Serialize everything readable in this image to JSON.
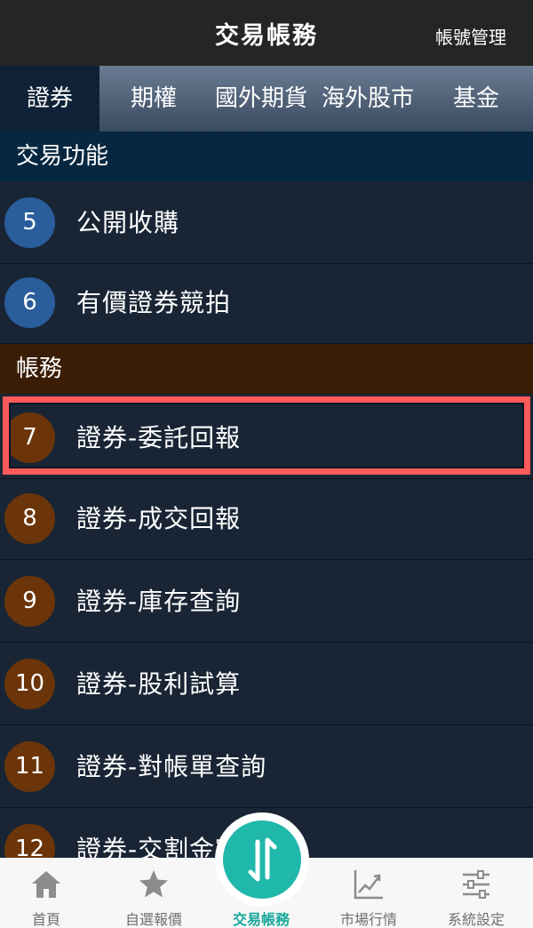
{
  "header": {
    "title": "交易帳務",
    "account_manage": "帳號管理"
  },
  "tabs": [
    {
      "label": "證券",
      "active": true
    },
    {
      "label": "期權"
    },
    {
      "label": "國外期貨"
    },
    {
      "label": "海外股市"
    },
    {
      "label": "基金"
    }
  ],
  "sections": {
    "trade": {
      "title": "交易功能",
      "items": [
        {
          "num": "5",
          "label": "公開收購"
        },
        {
          "num": "6",
          "label": "有價證券競拍"
        }
      ]
    },
    "account": {
      "title": "帳務",
      "items": [
        {
          "num": "7",
          "label": "證券-委託回報",
          "highlighted": true
        },
        {
          "num": "8",
          "label": "證券-成交回報"
        },
        {
          "num": "9",
          "label": "證券-庫存查詢"
        },
        {
          "num": "10",
          "label": "證券-股利試算"
        },
        {
          "num": "11",
          "label": "證券-對帳單查詢"
        },
        {
          "num": "12",
          "label": "證券-交割金額查詢"
        }
      ]
    }
  },
  "bottom_nav": [
    {
      "label": "首頁",
      "icon": "home-icon"
    },
    {
      "label": "自選報價",
      "icon": "star-icon"
    },
    {
      "label": "交易帳務",
      "icon": "transfer-arrows-icon",
      "active": true
    },
    {
      "label": "市場行情",
      "icon": "chart-icon"
    },
    {
      "label": "系統設定",
      "icon": "sliders-icon"
    }
  ],
  "colors": {
    "highlight": "#ff5a5a",
    "accent": "#1fb8aa",
    "trade_badge": "#2a5d9c",
    "account_badge": "#6b3509"
  }
}
